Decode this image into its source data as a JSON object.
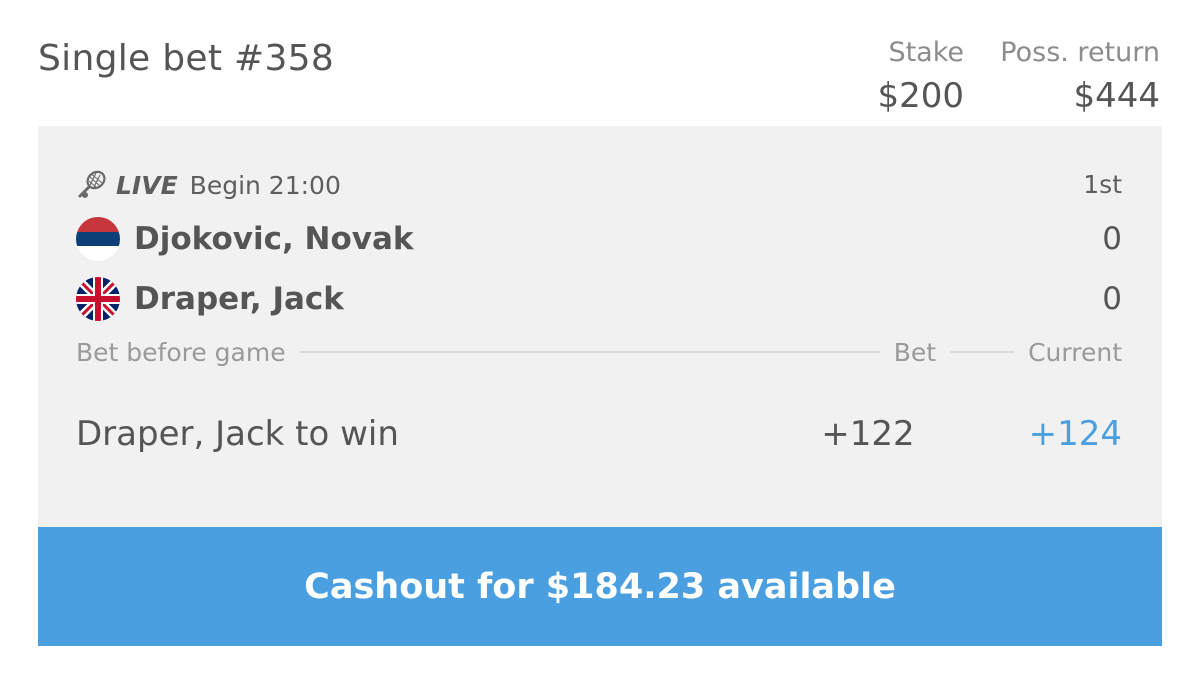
{
  "bet": {
    "title": "Single bet #358",
    "stake_label": "Stake",
    "stake_value": "$200",
    "return_label": "Poss. return",
    "return_value": "$444"
  },
  "event": {
    "sport_icon": "tennis-racket-icon",
    "live_label": "LIVE",
    "begin_text": "Begin 21:00",
    "period": "1st",
    "players": [
      {
        "name": "Djokovic, Novak",
        "score": "0",
        "flag": "serbia-flag-icon"
      },
      {
        "name": "Draper, Jack",
        "score": "0",
        "flag": "uk-flag-icon"
      }
    ]
  },
  "selection": {
    "header_label": "Bet before game",
    "bet_header": "Bet",
    "current_header": "Current",
    "market": "Draper, Jack to win",
    "bet_odds": "+122",
    "current_odds": "+124"
  },
  "cashout": {
    "label": "Cashout for $184.23 available"
  },
  "colors": {
    "accent": "#4a9fe0",
    "card_background": "#f1f1f1",
    "text": "#555555"
  }
}
